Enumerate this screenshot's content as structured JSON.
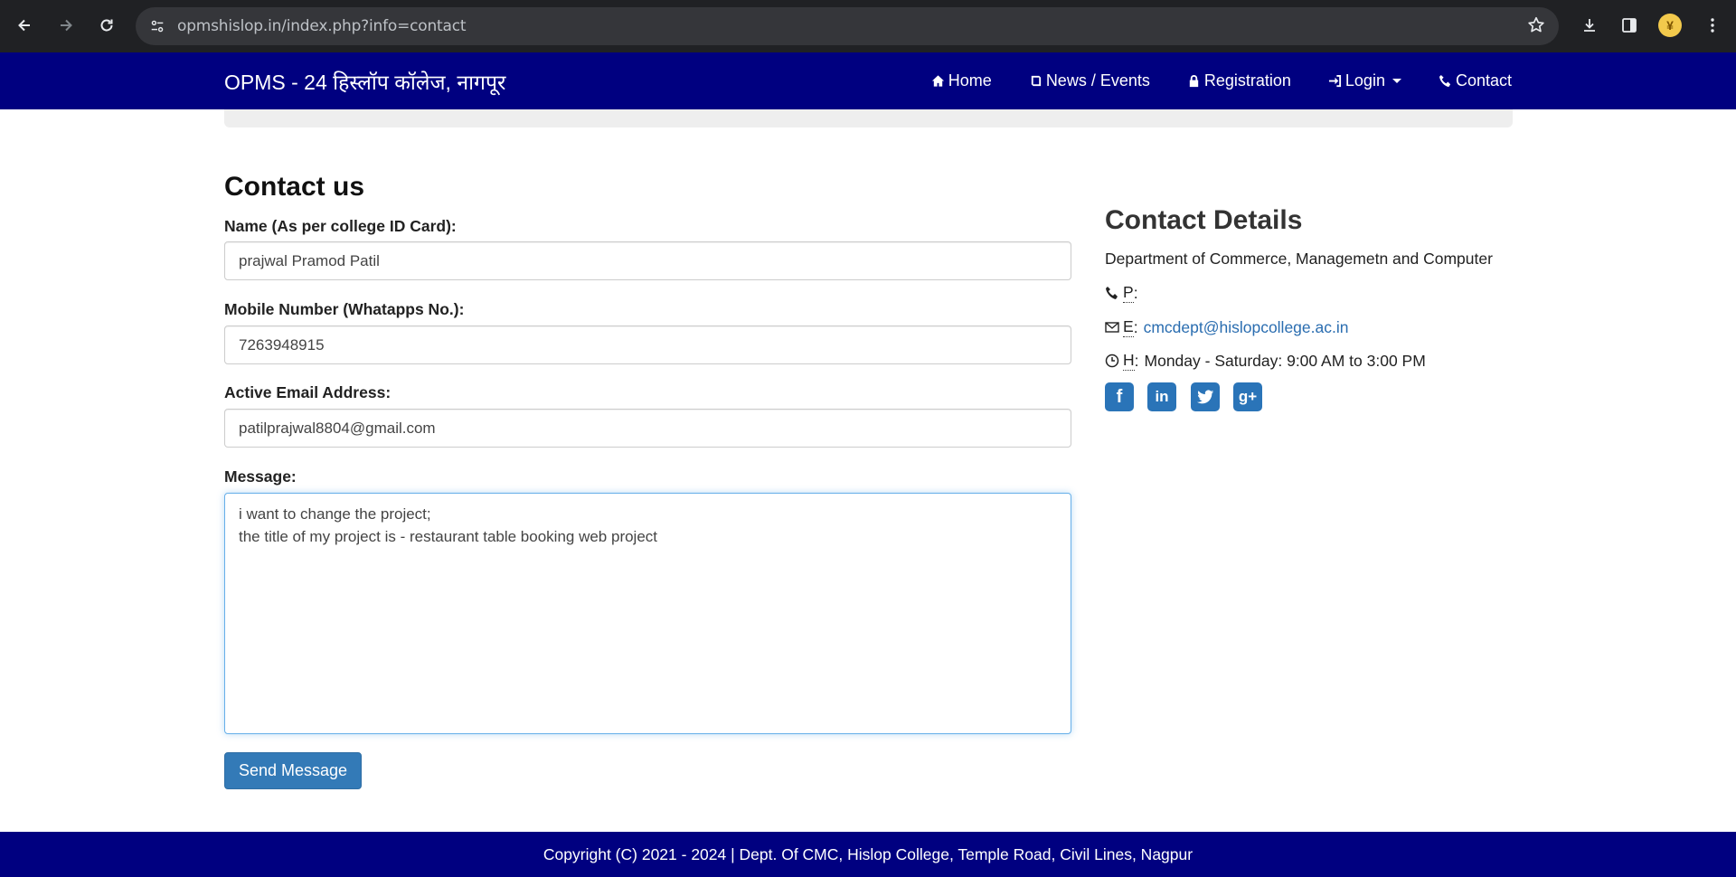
{
  "browser": {
    "url": "opmshislop.in/index.php?info=contact",
    "avatar_glyph": "¥"
  },
  "site": {
    "brand": "OPMS - 24 हिस्लॉप कॉलेज, नागपूर",
    "nav": {
      "home": "Home",
      "news": "News / Events",
      "registration": "Registration",
      "login": "Login",
      "contact": "Contact"
    }
  },
  "form": {
    "title": "Contact us",
    "name_label": "Name (As per college ID Card):",
    "name_value": "prajwal Pramod Patil",
    "mobile_label": "Mobile Number (Whatapps No.):",
    "mobile_value": "7263948915",
    "email_label": "Active Email Address:",
    "email_value": "patilprajwal8804@gmail.com",
    "message_label": "Message:",
    "message_value": "i want to change the project;\nthe title of my project is - restaurant table booking web project",
    "send_label": "Send Message"
  },
  "details": {
    "title": "Contact Details",
    "department": "Department of Commerce, Managemetn and Computer",
    "phone_abbr": "P",
    "phone_value": "",
    "email_abbr": "E",
    "email_value": "cmcdept@hislopcollege.ac.in",
    "hours_abbr": "H",
    "hours_value": "Monday - Saturday: 9:00 AM to 3:00 PM",
    "social_icons": [
      "facebook-icon",
      "linkedin-icon",
      "twitter-icon",
      "google-plus-icon"
    ]
  },
  "footer": {
    "text": "Copyright (C) 2021 - 2024 | Dept. Of CMC, Hislop College, Temple Road, Civil Lines, Nagpur"
  },
  "colors": {
    "navbar": "#000080",
    "button": "#337ab7",
    "link": "#2a6db0",
    "social": "#2a74b8"
  }
}
